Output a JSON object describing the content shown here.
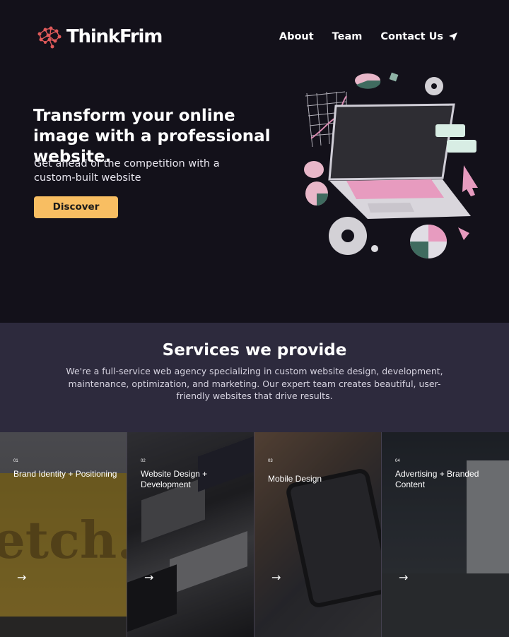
{
  "brand": {
    "name": "ThinkFrim",
    "accent": "#e05a5a"
  },
  "nav": {
    "items": [
      {
        "label": "About"
      },
      {
        "label": "Team"
      },
      {
        "label": "Contact Us",
        "icon": "send-icon"
      }
    ]
  },
  "hero": {
    "headline": "Transform your online image with a professional website.",
    "subline": "Get ahead of the competition with a custom-built website",
    "cta_label": "Discover",
    "cta_color": "#f8be62"
  },
  "services": {
    "title": "Services we provide",
    "description": "We're a full-service web agency specializing in custom website design, development, maintenance, optimization, and marketing. Our expert team creates beautiful, user-friendly websites that drive results.",
    "cards": [
      {
        "number": "01",
        "title": "Brand Identity + Positioning",
        "arrow": "→"
      },
      {
        "number": "02",
        "title": "Website Design + Development",
        "arrow": "→"
      },
      {
        "number": "03",
        "title": "Mobile Design",
        "arrow": "→"
      },
      {
        "number": "04",
        "title": "Advertising + Branded Content",
        "arrow": "→"
      }
    ]
  }
}
